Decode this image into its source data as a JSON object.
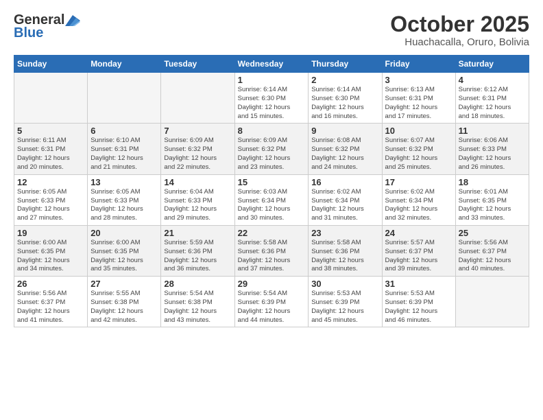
{
  "header": {
    "logo_general": "General",
    "logo_blue": "Blue",
    "month_title": "October 2025",
    "location": "Huachacalla, Oruro, Bolivia"
  },
  "weekdays": [
    "Sunday",
    "Monday",
    "Tuesday",
    "Wednesday",
    "Thursday",
    "Friday",
    "Saturday"
  ],
  "weeks": [
    [
      {
        "day": "",
        "info": ""
      },
      {
        "day": "",
        "info": ""
      },
      {
        "day": "",
        "info": ""
      },
      {
        "day": "1",
        "info": "Sunrise: 6:14 AM\nSunset: 6:30 PM\nDaylight: 12 hours\nand 15 minutes."
      },
      {
        "day": "2",
        "info": "Sunrise: 6:14 AM\nSunset: 6:30 PM\nDaylight: 12 hours\nand 16 minutes."
      },
      {
        "day": "3",
        "info": "Sunrise: 6:13 AM\nSunset: 6:31 PM\nDaylight: 12 hours\nand 17 minutes."
      },
      {
        "day": "4",
        "info": "Sunrise: 6:12 AM\nSunset: 6:31 PM\nDaylight: 12 hours\nand 18 minutes."
      }
    ],
    [
      {
        "day": "5",
        "info": "Sunrise: 6:11 AM\nSunset: 6:31 PM\nDaylight: 12 hours\nand 20 minutes."
      },
      {
        "day": "6",
        "info": "Sunrise: 6:10 AM\nSunset: 6:31 PM\nDaylight: 12 hours\nand 21 minutes."
      },
      {
        "day": "7",
        "info": "Sunrise: 6:09 AM\nSunset: 6:32 PM\nDaylight: 12 hours\nand 22 minutes."
      },
      {
        "day": "8",
        "info": "Sunrise: 6:09 AM\nSunset: 6:32 PM\nDaylight: 12 hours\nand 23 minutes."
      },
      {
        "day": "9",
        "info": "Sunrise: 6:08 AM\nSunset: 6:32 PM\nDaylight: 12 hours\nand 24 minutes."
      },
      {
        "day": "10",
        "info": "Sunrise: 6:07 AM\nSunset: 6:32 PM\nDaylight: 12 hours\nand 25 minutes."
      },
      {
        "day": "11",
        "info": "Sunrise: 6:06 AM\nSunset: 6:33 PM\nDaylight: 12 hours\nand 26 minutes."
      }
    ],
    [
      {
        "day": "12",
        "info": "Sunrise: 6:05 AM\nSunset: 6:33 PM\nDaylight: 12 hours\nand 27 minutes."
      },
      {
        "day": "13",
        "info": "Sunrise: 6:05 AM\nSunset: 6:33 PM\nDaylight: 12 hours\nand 28 minutes."
      },
      {
        "day": "14",
        "info": "Sunrise: 6:04 AM\nSunset: 6:33 PM\nDaylight: 12 hours\nand 29 minutes."
      },
      {
        "day": "15",
        "info": "Sunrise: 6:03 AM\nSunset: 6:34 PM\nDaylight: 12 hours\nand 30 minutes."
      },
      {
        "day": "16",
        "info": "Sunrise: 6:02 AM\nSunset: 6:34 PM\nDaylight: 12 hours\nand 31 minutes."
      },
      {
        "day": "17",
        "info": "Sunrise: 6:02 AM\nSunset: 6:34 PM\nDaylight: 12 hours\nand 32 minutes."
      },
      {
        "day": "18",
        "info": "Sunrise: 6:01 AM\nSunset: 6:35 PM\nDaylight: 12 hours\nand 33 minutes."
      }
    ],
    [
      {
        "day": "19",
        "info": "Sunrise: 6:00 AM\nSunset: 6:35 PM\nDaylight: 12 hours\nand 34 minutes."
      },
      {
        "day": "20",
        "info": "Sunrise: 6:00 AM\nSunset: 6:35 PM\nDaylight: 12 hours\nand 35 minutes."
      },
      {
        "day": "21",
        "info": "Sunrise: 5:59 AM\nSunset: 6:36 PM\nDaylight: 12 hours\nand 36 minutes."
      },
      {
        "day": "22",
        "info": "Sunrise: 5:58 AM\nSunset: 6:36 PM\nDaylight: 12 hours\nand 37 minutes."
      },
      {
        "day": "23",
        "info": "Sunrise: 5:58 AM\nSunset: 6:36 PM\nDaylight: 12 hours\nand 38 minutes."
      },
      {
        "day": "24",
        "info": "Sunrise: 5:57 AM\nSunset: 6:37 PM\nDaylight: 12 hours\nand 39 minutes."
      },
      {
        "day": "25",
        "info": "Sunrise: 5:56 AM\nSunset: 6:37 PM\nDaylight: 12 hours\nand 40 minutes."
      }
    ],
    [
      {
        "day": "26",
        "info": "Sunrise: 5:56 AM\nSunset: 6:37 PM\nDaylight: 12 hours\nand 41 minutes."
      },
      {
        "day": "27",
        "info": "Sunrise: 5:55 AM\nSunset: 6:38 PM\nDaylight: 12 hours\nand 42 minutes."
      },
      {
        "day": "28",
        "info": "Sunrise: 5:54 AM\nSunset: 6:38 PM\nDaylight: 12 hours\nand 43 minutes."
      },
      {
        "day": "29",
        "info": "Sunrise: 5:54 AM\nSunset: 6:39 PM\nDaylight: 12 hours\nand 44 minutes."
      },
      {
        "day": "30",
        "info": "Sunrise: 5:53 AM\nSunset: 6:39 PM\nDaylight: 12 hours\nand 45 minutes."
      },
      {
        "day": "31",
        "info": "Sunrise: 5:53 AM\nSunset: 6:39 PM\nDaylight: 12 hours\nand 46 minutes."
      },
      {
        "day": "",
        "info": ""
      }
    ]
  ]
}
